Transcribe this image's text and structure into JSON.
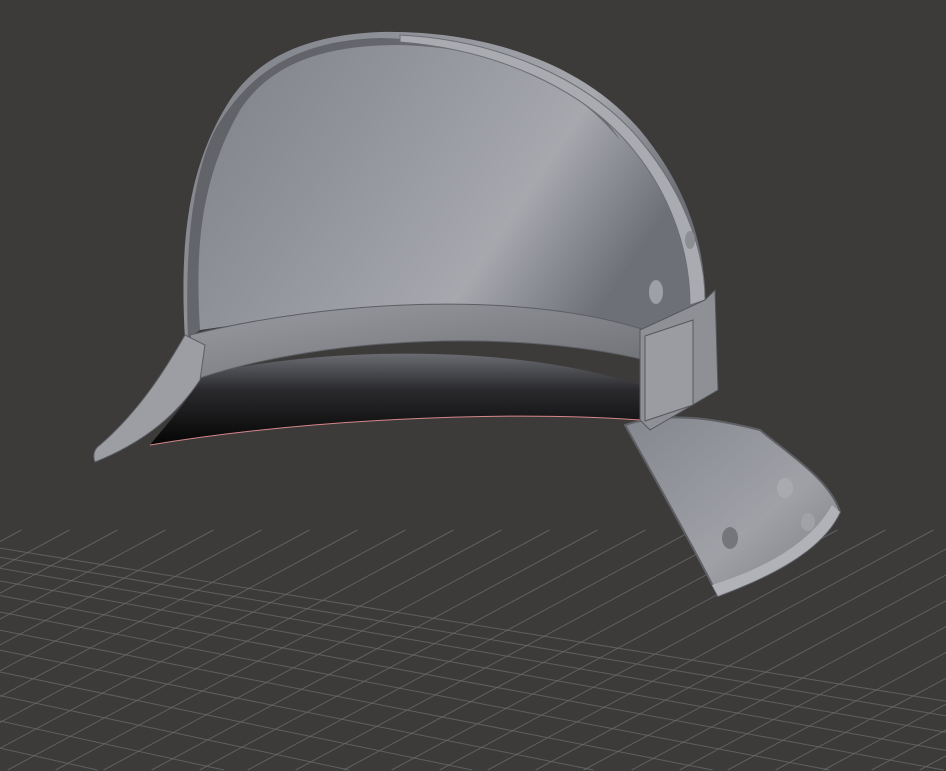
{
  "viewport": {
    "background": "#3c3b3a",
    "grid_color": "#6b6b6b",
    "model_color": "#8c8e95",
    "model": "helmet-mesh"
  }
}
